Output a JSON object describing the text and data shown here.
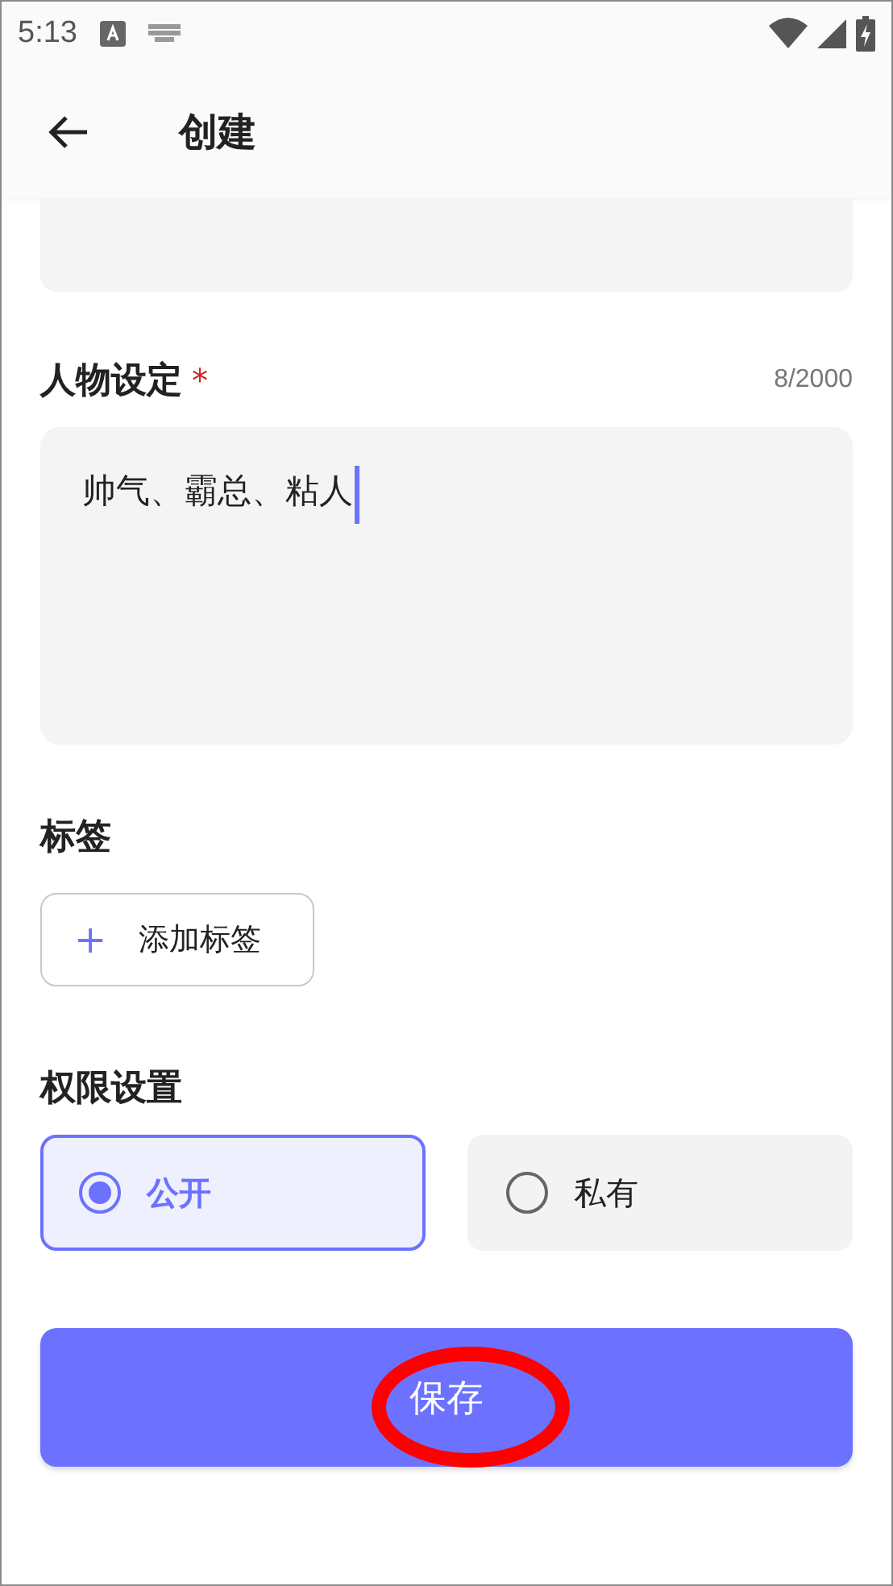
{
  "status_bar": {
    "time": "5:13"
  },
  "app_bar": {
    "title": "创建"
  },
  "persona": {
    "label": "人物设定",
    "required_mark": "*",
    "counter": "8/2000",
    "value": "帅气、霸总、粘人",
    "focused": true
  },
  "tags": {
    "label": "标签",
    "add_icon": "+",
    "add_label": "添加标签"
  },
  "permission": {
    "label": "权限设置",
    "options": [
      {
        "label": "公开",
        "selected": true
      },
      {
        "label": "私有",
        "selected": false
      }
    ]
  },
  "save_button": {
    "label": "保存",
    "highlighted": true
  }
}
